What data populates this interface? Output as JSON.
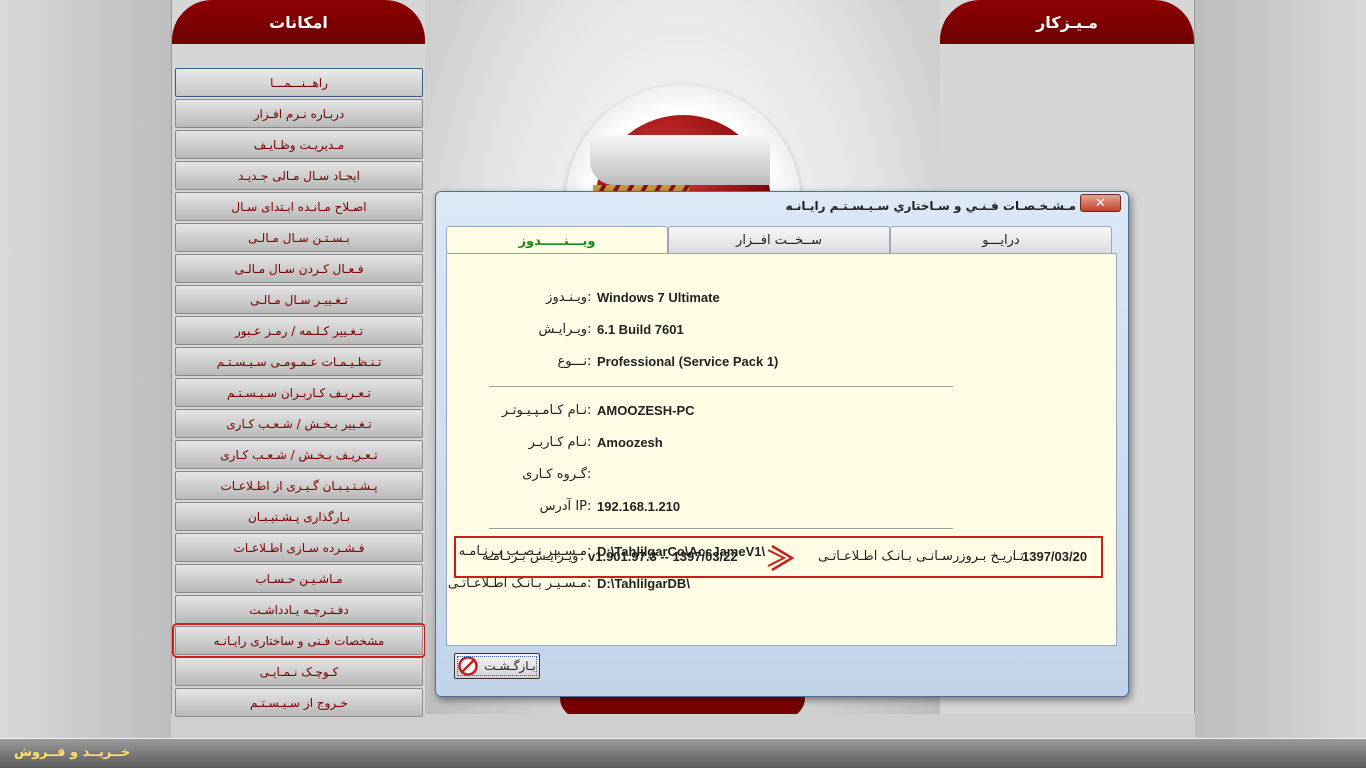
{
  "left_panel": {
    "title": "امکانات",
    "menu": [
      "راهــنـــمـــا",
      "دربـاره نـرم افـزار",
      "مـدیریـت وظـایـف",
      "ایجـاد سـال مـالی جـدیـد",
      "اصـلاح مـانـده ابـتدای سـال",
      "بـسـتـن سـال مـالـی",
      "فـعـال کـردن سـال مـالـی",
      "تـغـییـر سـال مـالـی",
      "تـغـییر کـلـمه / رمـز عـبور",
      "تـنـظـیـمـات عـمـومـی سـیـسـتـم",
      "تـعـریـف کـاربـران سـیـسـتـم",
      "تـغـییر بـخـش / شـعـب کـاری",
      "تـعـریـف بـخـش / شـعـب کـاری",
      "پـشـتـیـبـان گـیـری از اطـلاعـات",
      "بـارگذاری پـشـتیـبـان",
      "فـشـرده سـازی اطـلاعـات",
      "مـاشـیـن حـسـاب",
      "دفـتـرچـه یـادداشـت",
      "مشخصات فـنی و ساختاری رایـانـه",
      "کـوچـک نـمـایـی",
      "خـروج از سـیـسـتـم"
    ]
  },
  "right_panel": {
    "title": "مـیـزکار"
  },
  "taskbar": {
    "text": "خــریــد و فــروش"
  },
  "dialog": {
    "title": "مـشـخـصـات فـنـي و سـاختاري سـيـسـتـم رايـانـه",
    "close": "✕",
    "tabs": {
      "windows": "ویـــنـــــدوز",
      "hardware": "ســخــت افــزار",
      "drive": "درایـــو"
    },
    "os": {
      "windows_label": "ویـنـدوز",
      "windows_value": "Windows 7 Ultimate",
      "version_label": "ویـرایـش",
      "version_value": "6.1 Build 7601",
      "type_label": "نـــوع",
      "type_value": "Professional (Service Pack 1)"
    },
    "network": {
      "computer_label": "نـام کـامـپـیـوتـر",
      "computer_value": "AMOOZESH-PC",
      "user_label": "نـام کـاربـر",
      "user_value": "Amoozesh",
      "workgroup_label": "گـروه کـاری",
      "workgroup_value": "",
      "ip_label": "IP آدرس",
      "ip_value": "192.168.1.210"
    },
    "paths": {
      "install_label": "مـسـیـر نـصـب بـرنـامـه",
      "install_value": "D:\\TahlilgarCo\\AccJameV1\\",
      "db_label": "مـسـیـر بـانـک اطـلاعـاتـی",
      "db_value": "D:\\TahlilgarDB\\"
    },
    "version": {
      "label": "ویـرایـش بـرنـامـه",
      "value": "v1.901.97.3  --  1397/03/22",
      "db_update_label": "تـاریـخ بـروزرسـانـی بـانـک اطـلاعـاتـی",
      "db_update_value": "1397/03/20"
    },
    "back_button": "بـازگـشـت"
  }
}
